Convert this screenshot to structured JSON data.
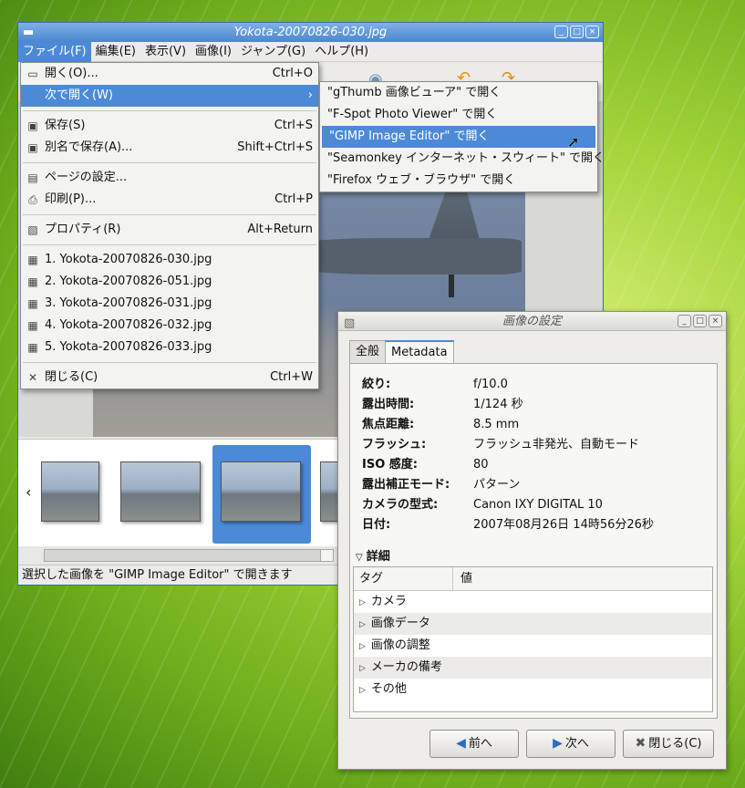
{
  "main_window": {
    "title": "Yokota-20070826-030.jpg",
    "menubar": [
      "ファイル(F)",
      "編集(E)",
      "表示(V)",
      "画像(I)",
      "ジャンプ(G)",
      "ヘルプ(H)"
    ],
    "status": "選択した画像を \"GIMP Image Editor\" で開きます"
  },
  "file_menu": {
    "open": {
      "label": "開く(O)...",
      "accel": "Ctrl+O"
    },
    "open_with": {
      "label": "次で開く(W)"
    },
    "save": {
      "label": "保存(S)",
      "accel": "Ctrl+S"
    },
    "save_as": {
      "label": "別名で保存(A)...",
      "accel": "Shift+Ctrl+S"
    },
    "page_setup": {
      "label": "ページの設定..."
    },
    "print": {
      "label": "印刷(P)...",
      "accel": "Ctrl+P"
    },
    "properties": {
      "label": "プロパティ(R)",
      "accel": "Alt+Return"
    },
    "recent": [
      "1. Yokota-20070826-030.jpg",
      "2. Yokota-20070826-051.jpg",
      "3. Yokota-20070826-031.jpg",
      "4. Yokota-20070826-032.jpg",
      "5. Yokota-20070826-033.jpg"
    ],
    "close": {
      "label": "閉じる(C)",
      "accel": "Ctrl+W"
    }
  },
  "open_with_menu": [
    "\"gThumb 画像ビューア\" で開く",
    "\"F-Spot Photo Viewer\" で開く",
    "\"GIMP Image Editor\" で開く",
    "\"Seamonkey インターネット・スウィート\" で開く",
    "\"Firefox ウェブ・ブラウザ\" で開く"
  ],
  "dialog": {
    "title": "画像の設定",
    "tabs": [
      "全般",
      "Metadata"
    ],
    "metadata": [
      {
        "key": "絞り:",
        "value": "f/10.0"
      },
      {
        "key": "露出時間:",
        "value": "1/124 秒"
      },
      {
        "key": "焦点距離:",
        "value": "8.5 mm"
      },
      {
        "key": "フラッシュ:",
        "value": "フラッシュ非発光、自動モード"
      },
      {
        "key": "ISO 感度:",
        "value": "80"
      },
      {
        "key": "露出補正モード:",
        "value": "パターン"
      },
      {
        "key": "カメラの型式:",
        "value": "Canon IXY DIGITAL 10"
      },
      {
        "key": "日付:",
        "value": "2007年08月26日 14時56分26秒"
      }
    ],
    "details_label": "詳細",
    "table_headers": [
      "タグ",
      "値"
    ],
    "table_rows": [
      "カメラ",
      "画像データ",
      "画像の調整",
      "メーカの備考",
      "その他"
    ],
    "buttons": {
      "prev": "前へ",
      "next": "次へ",
      "close": "閉じる(C)"
    }
  },
  "colors": {
    "selection": "#4c8ad8",
    "titlebar": "#4b86cf"
  }
}
